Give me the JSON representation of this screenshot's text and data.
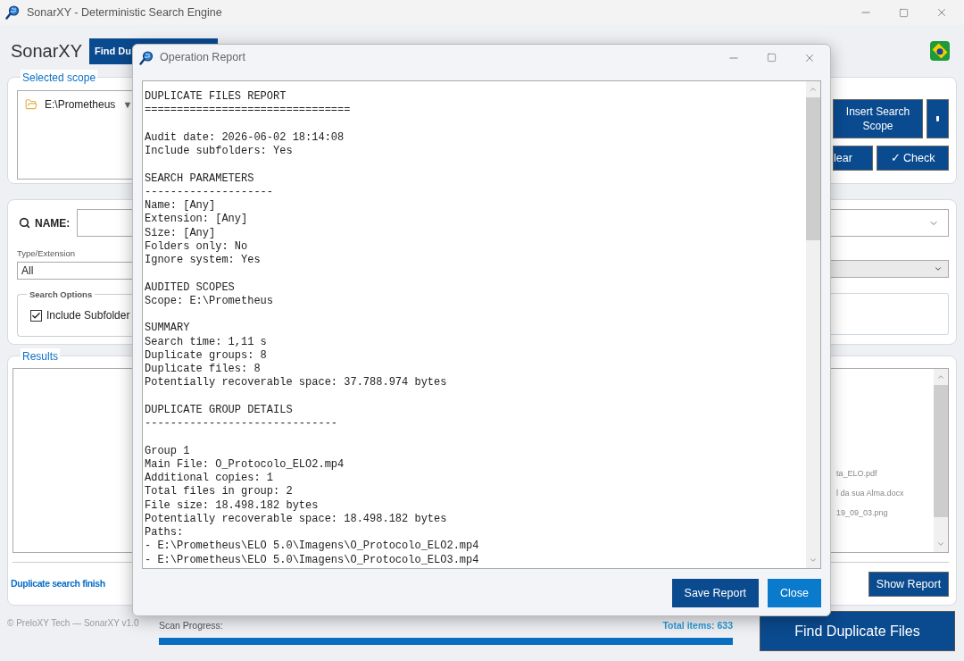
{
  "window": {
    "title": "SonarXY - Deterministic Search Engine"
  },
  "app": {
    "name": "SonarXY",
    "tabs": [
      {
        "label": "Find Du",
        "selected": true
      }
    ]
  },
  "scope_panel": {
    "legend": "Selected scope",
    "scopes": [
      {
        "path": "E:\\Prometheus",
        "caret": "▼"
      }
    ],
    "insert_button": "Insert Search\nScope",
    "clear_button": "lear",
    "check_button": "✓ Check"
  },
  "filters": {
    "name_label": "NAME:",
    "type_label": "Type/Extension",
    "type_value": "All",
    "options_legend": "Search Options",
    "options": [
      {
        "label": "Include Subfolder",
        "checked": true
      }
    ]
  },
  "results": {
    "legend": "Results",
    "items": [
      "ta_ELO.pdf",
      "l da sua Alma.docx",
      "19_09_03.png"
    ],
    "status": "Duplicate search finish",
    "show_report_button": "Show Report"
  },
  "footer": {
    "copyright": "© PreloXY Tech — SonarXY v1.0",
    "progress_label": "Scan Progress:",
    "total": "Total items: 633",
    "progress": {
      "level": 1.0
    },
    "find_button": "Find Duplicate Files"
  },
  "dialog": {
    "title": "Operation Report",
    "report_blocks": [
      [
        "DUPLICATE FILES REPORT",
        "================================"
      ],
      [
        "Audit date: 2026-06-02 18:14:08",
        "Include subfolders: Yes"
      ],
      [
        "SEARCH PARAMETERS",
        "--------------------",
        "Name: [Any]",
        "Extension: [Any]",
        "Size: [Any]",
        "Folders only: No",
        "Ignore system: Yes"
      ],
      [
        "AUDITED SCOPES",
        "Scope: E:\\Prometheus"
      ],
      [
        "SUMMARY",
        "Search time: 1,11 s",
        "Duplicate groups: 8",
        "Duplicate files: 8",
        "Potentially recoverable space: 37.788.974 bytes"
      ],
      [
        "DUPLICATE GROUP DETAILS",
        "------------------------------"
      ],
      [
        "Group 1",
        "Main File: O_Protocolo_ELO2.mp4",
        "Additional copies: 1",
        "Total files in group: 2",
        "File size: 18.498.182 bytes",
        "Potentially recoverable space: 18.498.182 bytes",
        "Paths:",
        "- E:\\Prometheus\\ELO 5.0\\Imagens\\O_Protocolo_ELO2.mp4",
        "- E:\\Prometheus\\ELO 5.0\\Imagens\\O_Protocolo_ELO3.mp4"
      ]
    ],
    "buttons": [
      {
        "label": "Save Report",
        "kind": "primary"
      },
      {
        "label": "Close",
        "kind": "accent"
      }
    ]
  }
}
